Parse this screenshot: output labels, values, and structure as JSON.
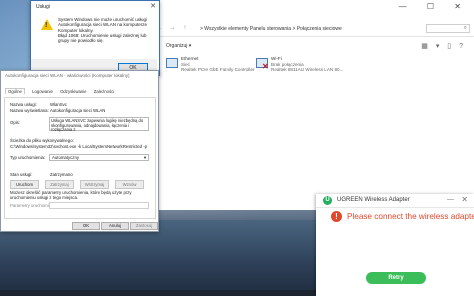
{
  "explorer": {
    "controls": "—  ☐  ✕",
    "nav": "← → ↑",
    "breadcrumb": "> Wszystkie elementy Panelu sterowania > Połączenia sieciowe",
    "search_placeholder": "⌕",
    "organize_label": "Organizuj ▾",
    "view_icons": "▦ ▾ ▯ ?",
    "adapters": [
      {
        "name": "Ethernet",
        "status": "Sieć",
        "device": "Realtek PCIe GbE Family Controller",
        "error": false
      },
      {
        "name": "Wi-Fi",
        "status": "Brak połączenia",
        "device": "Realtek 8811AU Wireless LAN 80...",
        "error": true
      }
    ]
  },
  "uslugi": {
    "title": "Usługi",
    "close": "✕",
    "message1": "System Windows nie może uruchomić usługi Autokonfiguracja sieci WLAN na komputerze Komputer lokalny.",
    "message2": "Błąd 1068: Uruchomienie usługi zależnej lub grupy nie powiodło się.",
    "ok_label": "OK"
  },
  "props": {
    "title": "Autokonfiguracja sieci WLAN - właściwości (Komputer lokalny)",
    "tabs": [
      "Ogólne",
      "Logowanie",
      "Odzyskiwanie",
      "Zależności"
    ],
    "service_name_label": "Nazwa usługi:",
    "service_name_value": "WlanSvc",
    "display_name_label": "Nazwa wyświetlana:",
    "display_name_value": "Autokonfiguracja sieci WLAN",
    "description_label": "Opis:",
    "description_value": "Usługa WLANSVC zapewnia logikę niezbędną do skonfigurowania, odnajdowania, łączenia i rozłączania z",
    "exe_path_label": "Ścieżka do pliku wykonywalnego:",
    "exe_path_value": "C:\\Windows\\system32\\svchost.exe -k LocalSystemNetworkRestricted -p",
    "startup_type_label": "Typ uruchomienia:",
    "startup_type_value": "Automatyczny",
    "status_label": "Stan usługi:",
    "status_value": "Zatrzymano",
    "btn_start": "Uruchom",
    "btn_stop": "Zatrzymaj",
    "btn_pause": "Wstrzymaj",
    "btn_resume": "Wznów",
    "params_hint": "Możesz określić parametry uruchomienia, które będą użyte przy uruchomieniu usługi z tego miejsca.",
    "params_label": "Parametry uruchomienia:",
    "btn_ok": "OK",
    "btn_cancel": "Anuluj",
    "btn_apply": "Zastosuj"
  },
  "ugreen": {
    "title": "UGREEN Wireless Adapter",
    "min": "—",
    "close": "✕",
    "error_message": "Please connect the wireless adapter.",
    "retry_label": "Retry",
    "accent": "#3bbd5a",
    "error_color": "#e0472c"
  }
}
